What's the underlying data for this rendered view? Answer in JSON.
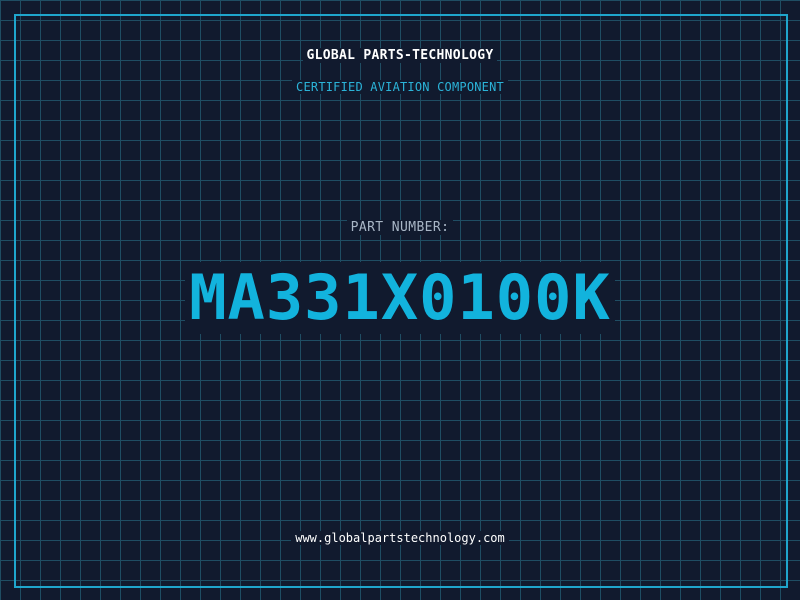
{
  "certificate": {
    "company": "GLOBAL PARTS-TECHNOLOGY",
    "tagline": "CERTIFIED AVIATION COMPONENT",
    "part_number_label": "PART NUMBER:",
    "part_number": "MA331X0100K",
    "website": "www.globalpartstechnology.com"
  },
  "colors": {
    "background": "#111a2e",
    "grid": "#1f4d63",
    "frame": "#1fa5cc",
    "accent": "#12b3dd"
  }
}
